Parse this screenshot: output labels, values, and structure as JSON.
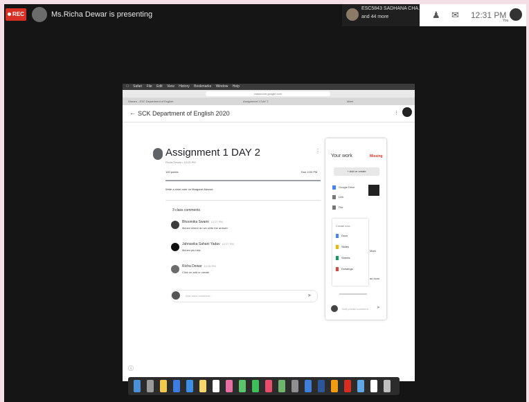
{
  "meet": {
    "rec_label": "REC",
    "presenting_text": "Ms.Richa Dewar is presenting",
    "participant_name": "ESC5843 SADHANA CHA...",
    "participant_more": "and 44 more",
    "time": "12:31 PM",
    "self_label": "You"
  },
  "browser": {
    "menu_items": [
      "Safari",
      "File",
      "Edit",
      "View",
      "History",
      "Bookmarks",
      "Window",
      "Help"
    ],
    "address": "classroom.google.com",
    "tabs": [
      "Stream - ESC Department of English",
      "Assignment 1 DAY 2",
      "Meet"
    ]
  },
  "classroom": {
    "class_name": "SCK Department of English 2020",
    "assignment_title": "Assignment 1 DAY 2",
    "meta": "Richa Dewar • 12:03 PM",
    "points": "100 points",
    "due": "Due 4:00 PM",
    "instructions": "Write a short note on Margaret Atwood.",
    "comments_count": "3 class comments",
    "comments": [
      {
        "author": "Bhoomika Swami",
        "time": "12:27 PM",
        "text": "Ma'am where do we write the answer"
      },
      {
        "author": "Jahnavika Sahani Yadav",
        "time": "12:27 PM",
        "text": "Ma'am pls help"
      },
      {
        "author": "Richa Dewar",
        "time": "12:28 PM",
        "text": "Click on add or create"
      }
    ],
    "add_comment_placeholder": "Add class comment...",
    "your_work": {
      "title": "Your work",
      "status": "Missing",
      "add_create": "+ Add or create",
      "menu": [
        "Google Drive",
        "Link",
        "File"
      ],
      "create_new_label": "Create new",
      "create_items": [
        "Docs",
        "Slides",
        "Sheets",
        "Drawings"
      ],
      "side_note_1": "Mark",
      "side_note_2": "as done",
      "private_comment_placeholder": "Add private comment..."
    }
  },
  "colors": {
    "rec": "#d93025",
    "missing": "#d93025",
    "meet_bg": "#151515",
    "outer_bg": "#f4dfe7"
  },
  "dock_icons": [
    "finder",
    "launchpad",
    "chrome",
    "safari",
    "app-store",
    "notes",
    "calendar",
    "photos",
    "messages",
    "facetime",
    "music",
    "maps",
    "system-preferences",
    "keynote",
    "word",
    "pages",
    "acrobat",
    "preview",
    "documents",
    "trash"
  ]
}
